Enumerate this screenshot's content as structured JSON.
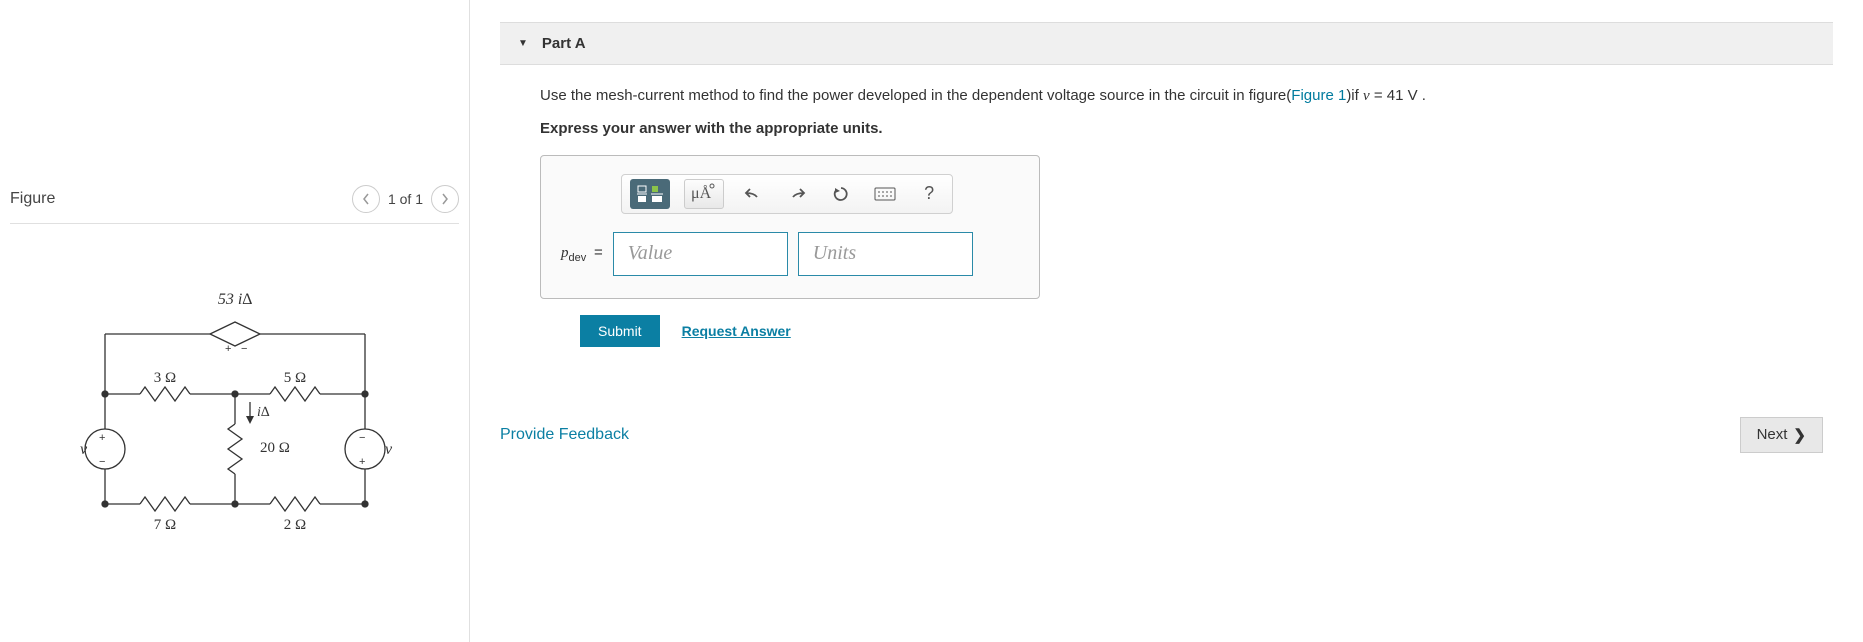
{
  "figure": {
    "title": "Figure",
    "nav": {
      "position": "1 of 1"
    },
    "circuit": {
      "dep_source_label": "53 i∆",
      "r1": "3 Ω",
      "r2": "5 Ω",
      "r3": "20 Ω",
      "r4": "7 Ω",
      "r5": "2 Ω",
      "i_label": "i∆",
      "v_left": "v",
      "v_right": "v"
    }
  },
  "part": {
    "label": "Part A",
    "question_prefix": "Use the mesh-current method to find the power developed in the dependent voltage source in the circuit in figure(",
    "figure_link": "Figure 1",
    "question_mid": ")if ",
    "var_v": "v",
    "question_suffix": " = 41 V .",
    "instruction": "Express your answer with the appropriate units.",
    "toolbar": {
      "units_btn": "μÅ",
      "help": "?"
    },
    "answer": {
      "label_var": "p",
      "label_sub": "dev",
      "equals": "=",
      "value_placeholder": "Value",
      "units_placeholder": "Units"
    },
    "submit": "Submit",
    "request": "Request Answer"
  },
  "footer": {
    "feedback": "Provide Feedback",
    "next": "Next"
  }
}
